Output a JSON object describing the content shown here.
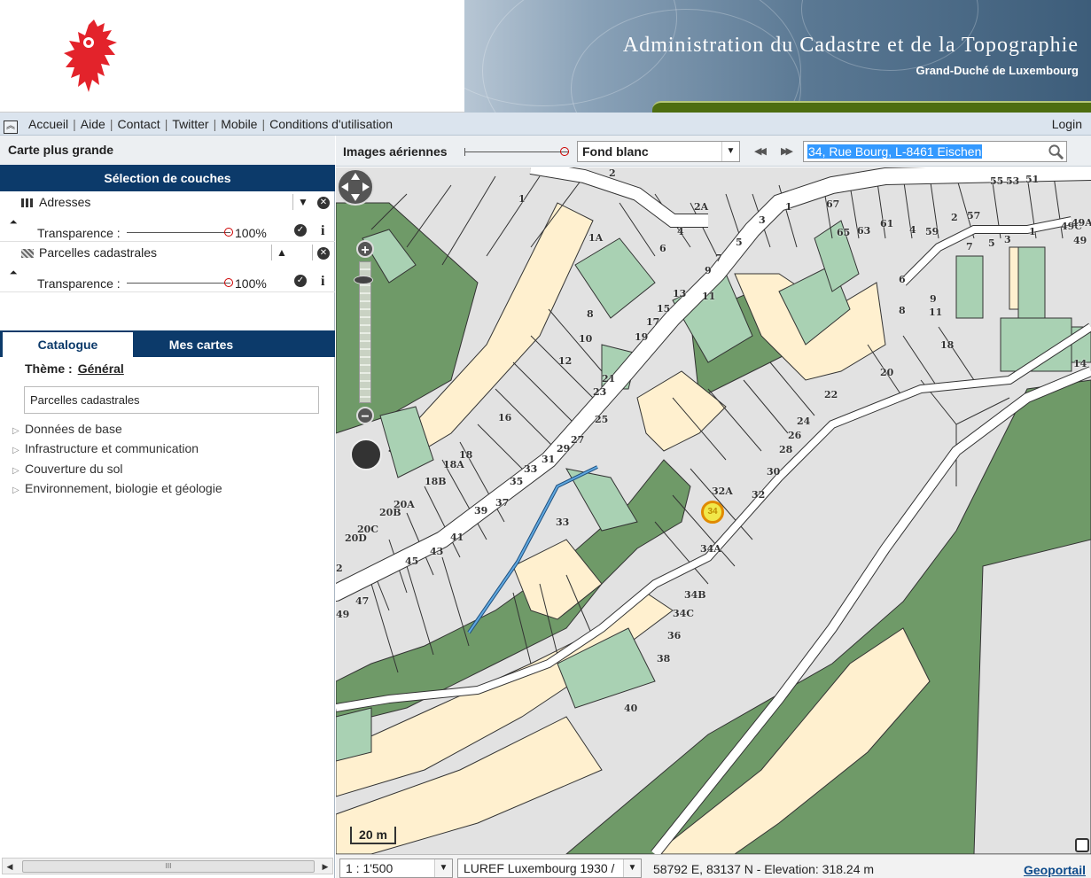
{
  "header": {
    "title": "Administration du Cadastre et de la Topographie",
    "subtitle": "Grand-Duché de Luxembourg"
  },
  "nav": {
    "links": [
      "Accueil",
      "Aide",
      "Contact",
      "Twitter",
      "Mobile",
      "Conditions d'utilisation"
    ],
    "login": "Login"
  },
  "left": {
    "bigger_map": "Carte plus grande",
    "layers_header": "Sélection de couches",
    "layers": [
      {
        "name": "Adresses",
        "transparency_label": "Transparence :",
        "transparency": "100%"
      },
      {
        "name": "Parcelles cadastrales",
        "transparency_label": "Transparence :",
        "transparency": "100%"
      }
    ],
    "tabs": [
      "Catalogue",
      "Mes cartes"
    ],
    "theme_label": "Thème :",
    "theme_value": "Général",
    "theme_box": "Parcelles cadastrales",
    "tree": [
      "Données de base",
      "Infrastructure et communication",
      "Couverture du sol",
      "Environnement, biologie et géologie"
    ],
    "scroll_thumb": "III"
  },
  "toolbar": {
    "aerial_label": "Images aériennes",
    "background_select": "Fond blanc",
    "search_value": "34, Rue Bourg, L-8461 Eischen"
  },
  "map": {
    "scale_label": "20 m",
    "marker_label": "34",
    "colors": {
      "dark_green": "#6f9a68",
      "light_green": "#a9d1b3",
      "cream": "#fff0cf",
      "gray": "#e2e2e2",
      "road": "#ffffff",
      "route": "#3a84c8"
    },
    "parcels": [
      "1",
      "2",
      "2A",
      "3",
      "1",
      "67",
      "55",
      "53",
      "51",
      "1A",
      "4",
      "6",
      "5",
      "65",
      "63",
      "61",
      "4",
      "59",
      "2",
      "57",
      "49C",
      "49A",
      "49",
      "7",
      "5",
      "3",
      "1",
      "7",
      "9",
      "11",
      "13",
      "15",
      "17",
      "19",
      "8",
      "10",
      "12",
      "6",
      "8",
      "9",
      "11",
      "18",
      "20",
      "14",
      "21",
      "23",
      "22",
      "25",
      "24",
      "26",
      "28",
      "30",
      "16",
      "27",
      "29",
      "31",
      "33",
      "35",
      "18",
      "18A",
      "18B",
      "32A",
      "32",
      "34A",
      "20A",
      "20B",
      "20C",
      "20D",
      "37",
      "39",
      "41",
      "43",
      "45",
      "47",
      "49",
      "33",
      "34B",
      "34C",
      "36",
      "38",
      "40",
      "2"
    ]
  },
  "status": {
    "scale_select": "1 : 1'500",
    "projection_select": "LUREF Luxembourg 1930 /",
    "coords": "58792 E, 83137 N  - Elevation: 318.24 m",
    "geoportail": "Geoportail"
  }
}
